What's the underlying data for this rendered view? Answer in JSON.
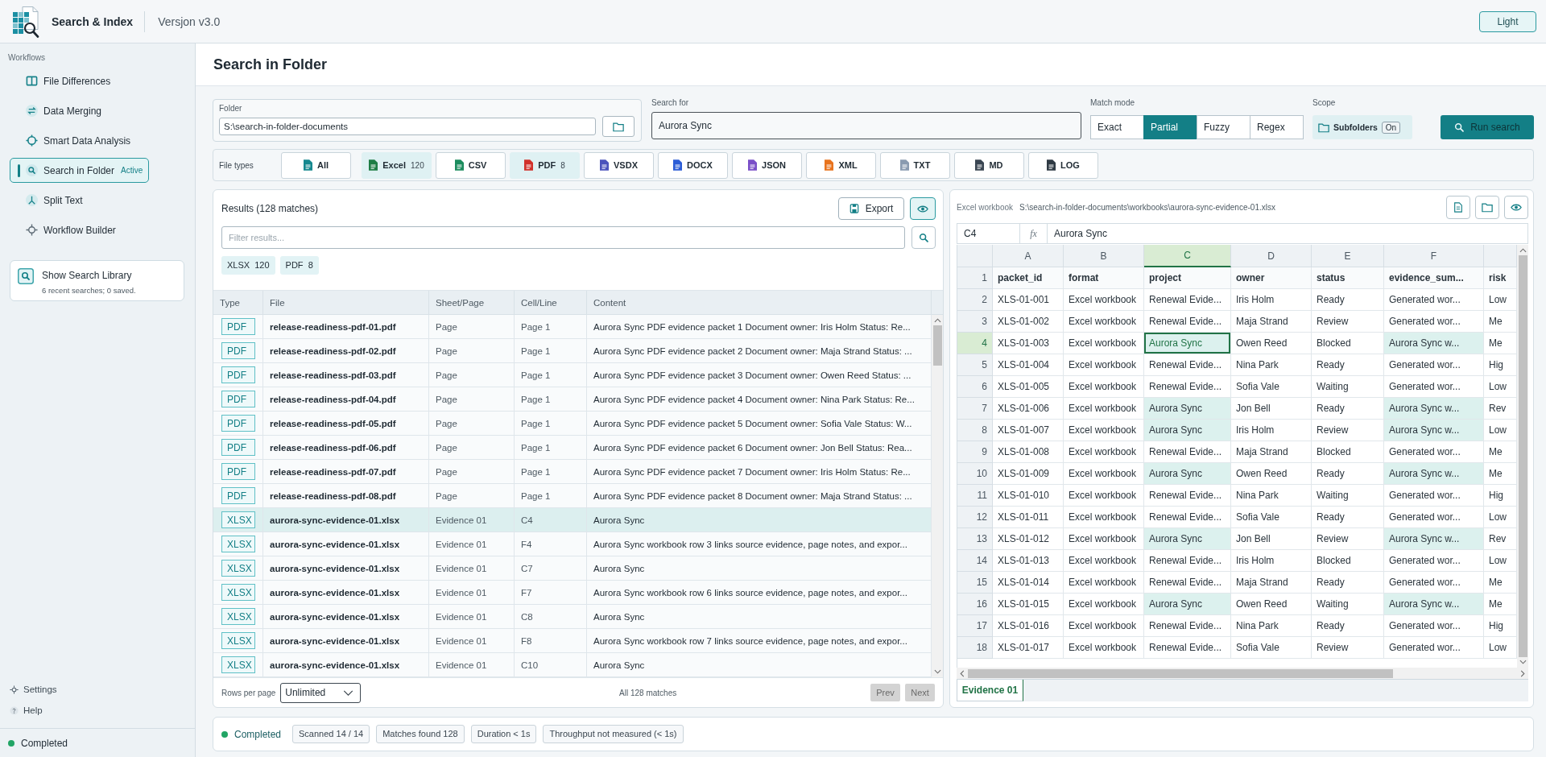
{
  "app": {
    "title": "Search & Index",
    "version": "Versjon v3.0",
    "theme_button": "Light"
  },
  "sidebar": {
    "section_label": "Workflows",
    "items": [
      {
        "label": "File Differences",
        "selected": false
      },
      {
        "label": "Data Merging",
        "selected": false
      },
      {
        "label": "Smart Data Analysis",
        "selected": false
      },
      {
        "label": "Search in Folder",
        "selected": true,
        "badge": "Active"
      },
      {
        "label": "Split Text",
        "selected": false
      },
      {
        "label": "Workflow Builder",
        "selected": false
      }
    ],
    "library_card": {
      "title": "Show Search Library",
      "subtitle": "6 recent searches; 0 saved."
    },
    "footer_links": [
      "Settings",
      "Help"
    ],
    "status": {
      "label": "Completed",
      "ok": true
    }
  },
  "page": {
    "title": "Search in Folder"
  },
  "search": {
    "folder": {
      "label": "Folder",
      "value": "S:\\search-in-folder-documents"
    },
    "query": {
      "label": "Search for",
      "value": "Aurora Sync",
      "focused": true
    },
    "match_mode": {
      "label": "Match mode",
      "options": [
        {
          "label": "Exact",
          "selected": false
        },
        {
          "label": "Partial",
          "selected": true
        },
        {
          "label": "Fuzzy",
          "selected": false
        },
        {
          "label": "Regex",
          "selected": false
        }
      ]
    },
    "scope": {
      "label": "Scope",
      "option": "Subfolders",
      "toggle": "On",
      "on": true
    },
    "run_button": "Run search"
  },
  "file_types": {
    "label": "File types",
    "items": [
      {
        "label": "All",
        "selected": false,
        "color": "#16888f"
      },
      {
        "label": "Excel",
        "count": "120",
        "selected": true,
        "color": "#1e7d45"
      },
      {
        "label": "CSV",
        "selected": false,
        "color": "#1c8c5e"
      },
      {
        "label": "PDF",
        "count": "8",
        "selected": true,
        "color": "#d1312b"
      },
      {
        "label": "VSDX",
        "selected": false,
        "color": "#4b53bc"
      },
      {
        "label": "DOCX",
        "selected": false,
        "color": "#2b5cd6"
      },
      {
        "label": "JSON",
        "selected": false,
        "color": "#7a4fc8"
      },
      {
        "label": "XML",
        "selected": false,
        "color": "#e8731d"
      },
      {
        "label": "TXT",
        "selected": false,
        "color": "#8a9bb0"
      },
      {
        "label": "MD",
        "selected": false,
        "color": "#3a4652"
      },
      {
        "label": "LOG",
        "selected": false,
        "color": "#2f3a44"
      }
    ]
  },
  "results": {
    "title": "Results (128 matches)",
    "export_button": "Export",
    "preview_toggle": {
      "on": true
    },
    "filter": {
      "placeholder": "Filter results..."
    },
    "type_chips": [
      {
        "label": "XLSX",
        "count": "120"
      },
      {
        "label": "PDF",
        "count": "8"
      }
    ],
    "columns": [
      "Type",
      "File",
      "Sheet/Page",
      "Cell/Line",
      "Content"
    ],
    "rows": [
      {
        "type": "PDF",
        "file": "release-readiness-pdf-01.pdf",
        "sheet": "Page",
        "cell": "Page 1",
        "content": "Aurora Sync PDF evidence packet 1 Document owner: Iris Holm Status: Re...",
        "selected": false
      },
      {
        "type": "PDF",
        "file": "release-readiness-pdf-02.pdf",
        "sheet": "Page",
        "cell": "Page 1",
        "content": "Aurora Sync PDF evidence packet 2 Document owner: Maja Strand Status: ...",
        "selected": false
      },
      {
        "type": "PDF",
        "file": "release-readiness-pdf-03.pdf",
        "sheet": "Page",
        "cell": "Page 1",
        "content": "Aurora Sync PDF evidence packet 3 Document owner: Owen Reed Status: ...",
        "selected": false
      },
      {
        "type": "PDF",
        "file": "release-readiness-pdf-04.pdf",
        "sheet": "Page",
        "cell": "Page 1",
        "content": "Aurora Sync PDF evidence packet 4 Document owner: Nina Park Status: Re...",
        "selected": false
      },
      {
        "type": "PDF",
        "file": "release-readiness-pdf-05.pdf",
        "sheet": "Page",
        "cell": "Page 1",
        "content": "Aurora Sync PDF evidence packet 5 Document owner: Sofia Vale Status: W...",
        "selected": false
      },
      {
        "type": "PDF",
        "file": "release-readiness-pdf-06.pdf",
        "sheet": "Page",
        "cell": "Page 1",
        "content": "Aurora Sync PDF evidence packet 6 Document owner: Jon Bell Status: Rea...",
        "selected": false
      },
      {
        "type": "PDF",
        "file": "release-readiness-pdf-07.pdf",
        "sheet": "Page",
        "cell": "Page 1",
        "content": "Aurora Sync PDF evidence packet 7 Document owner: Iris Holm Status: Re...",
        "selected": false
      },
      {
        "type": "PDF",
        "file": "release-readiness-pdf-08.pdf",
        "sheet": "Page",
        "cell": "Page 1",
        "content": "Aurora Sync PDF evidence packet 8 Document owner: Maja Strand Status: ...",
        "selected": false
      },
      {
        "type": "XLSX",
        "file": "aurora-sync-evidence-01.xlsx",
        "sheet": "Evidence 01",
        "cell": "C4",
        "content": "Aurora Sync",
        "selected": true
      },
      {
        "type": "XLSX",
        "file": "aurora-sync-evidence-01.xlsx",
        "sheet": "Evidence 01",
        "cell": "F4",
        "content": "Aurora Sync workbook row 3 links source evidence, page notes, and expor...",
        "selected": false
      },
      {
        "type": "XLSX",
        "file": "aurora-sync-evidence-01.xlsx",
        "sheet": "Evidence 01",
        "cell": "C7",
        "content": "Aurora Sync",
        "selected": false
      },
      {
        "type": "XLSX",
        "file": "aurora-sync-evidence-01.xlsx",
        "sheet": "Evidence 01",
        "cell": "F7",
        "content": "Aurora Sync workbook row 6 links source evidence, page notes, and expor...",
        "selected": false
      },
      {
        "type": "XLSX",
        "file": "aurora-sync-evidence-01.xlsx",
        "sheet": "Evidence 01",
        "cell": "C8",
        "content": "Aurora Sync",
        "selected": false
      },
      {
        "type": "XLSX",
        "file": "aurora-sync-evidence-01.xlsx",
        "sheet": "Evidence 01",
        "cell": "F8",
        "content": "Aurora Sync workbook row 7 links source evidence, page notes, and expor...",
        "selected": false
      },
      {
        "type": "XLSX",
        "file": "aurora-sync-evidence-01.xlsx",
        "sheet": "Evidence 01",
        "cell": "C10",
        "content": "Aurora Sync",
        "selected": false
      }
    ],
    "footer": {
      "rows_per_page_label": "Rows per page",
      "rows_per_page": "Unlimited",
      "summary": "All 128 matches",
      "prev": {
        "label": "Prev",
        "disabled": true
      },
      "next": {
        "label": "Next",
        "disabled": true
      }
    }
  },
  "preview": {
    "kind_label": "Excel workbook",
    "path": "S:\\search-in-folder-documents\\workbooks\\aurora-sync-evidence-01.xlsx",
    "formula_bar": {
      "cell": "C4",
      "fx": "fx",
      "value": "Aurora Sync"
    },
    "sheet": {
      "columns": [
        {
          "letter": "A",
          "selected": false
        },
        {
          "letter": "B",
          "selected": false
        },
        {
          "letter": "C",
          "selected": true
        },
        {
          "letter": "D",
          "selected": false
        },
        {
          "letter": "E",
          "selected": false
        },
        {
          "letter": "F",
          "selected": false
        }
      ],
      "rows": [
        {
          "number": "1",
          "selected": false,
          "header": true,
          "cells": [
            {
              "text": "packet_id",
              "match": false
            },
            {
              "text": "format",
              "match": false
            },
            {
              "text": "project",
              "match": false
            },
            {
              "text": "owner",
              "match": false
            },
            {
              "text": "status",
              "match": false
            },
            {
              "text": "evidence_sum...",
              "match": false
            },
            {
              "text": "risk",
              "match": false
            }
          ]
        },
        {
          "number": "2",
          "selected": false,
          "header": false,
          "cells": [
            {
              "text": "XLS-01-001",
              "match": false
            },
            {
              "text": "Excel workbook",
              "match": false
            },
            {
              "text": "Renewal Evide...",
              "match": false
            },
            {
              "text": "Iris Holm",
              "match": false
            },
            {
              "text": "Ready",
              "match": false
            },
            {
              "text": "Generated wor...",
              "match": false
            },
            {
              "text": "Low",
              "match": false
            }
          ]
        },
        {
          "number": "3",
          "selected": false,
          "header": false,
          "cells": [
            {
              "text": "XLS-01-002",
              "match": false
            },
            {
              "text": "Excel workbook",
              "match": false
            },
            {
              "text": "Renewal Evide...",
              "match": false
            },
            {
              "text": "Maja Strand",
              "match": false
            },
            {
              "text": "Review",
              "match": false
            },
            {
              "text": "Generated wor...",
              "match": false
            },
            {
              "text": "Me",
              "match": false
            }
          ]
        },
        {
          "number": "4",
          "selected": true,
          "header": false,
          "cells": [
            {
              "text": "XLS-01-003",
              "match": false
            },
            {
              "text": "Excel workbook",
              "match": false
            },
            {
              "text": "Aurora Sync",
              "match": true
            },
            {
              "text": "Owen Reed",
              "match": false
            },
            {
              "text": "Blocked",
              "match": false
            },
            {
              "text": "Aurora Sync w...",
              "match": true
            },
            {
              "text": "Me",
              "match": false
            }
          ]
        },
        {
          "number": "5",
          "selected": false,
          "header": false,
          "cells": [
            {
              "text": "XLS-01-004",
              "match": false
            },
            {
              "text": "Excel workbook",
              "match": false
            },
            {
              "text": "Renewal Evide...",
              "match": false
            },
            {
              "text": "Nina Park",
              "match": false
            },
            {
              "text": "Ready",
              "match": false
            },
            {
              "text": "Generated wor...",
              "match": false
            },
            {
              "text": "Hig",
              "match": false
            }
          ]
        },
        {
          "number": "6",
          "selected": false,
          "header": false,
          "cells": [
            {
              "text": "XLS-01-005",
              "match": false
            },
            {
              "text": "Excel workbook",
              "match": false
            },
            {
              "text": "Renewal Evide...",
              "match": false
            },
            {
              "text": "Sofia Vale",
              "match": false
            },
            {
              "text": "Waiting",
              "match": false
            },
            {
              "text": "Generated wor...",
              "match": false
            },
            {
              "text": "Low",
              "match": false
            }
          ]
        },
        {
          "number": "7",
          "selected": false,
          "header": false,
          "cells": [
            {
              "text": "XLS-01-006",
              "match": false
            },
            {
              "text": "Excel workbook",
              "match": false
            },
            {
              "text": "Aurora Sync",
              "match": true
            },
            {
              "text": "Jon Bell",
              "match": false
            },
            {
              "text": "Ready",
              "match": false
            },
            {
              "text": "Aurora Sync w...",
              "match": true
            },
            {
              "text": "Rev",
              "match": false
            }
          ]
        },
        {
          "number": "8",
          "selected": false,
          "header": false,
          "cells": [
            {
              "text": "XLS-01-007",
              "match": false
            },
            {
              "text": "Excel workbook",
              "match": false
            },
            {
              "text": "Aurora Sync",
              "match": true
            },
            {
              "text": "Iris Holm",
              "match": false
            },
            {
              "text": "Review",
              "match": false
            },
            {
              "text": "Aurora Sync w...",
              "match": true
            },
            {
              "text": "Low",
              "match": false
            }
          ]
        },
        {
          "number": "9",
          "selected": false,
          "header": false,
          "cells": [
            {
              "text": "XLS-01-008",
              "match": false
            },
            {
              "text": "Excel workbook",
              "match": false
            },
            {
              "text": "Renewal Evide...",
              "match": false
            },
            {
              "text": "Maja Strand",
              "match": false
            },
            {
              "text": "Blocked",
              "match": false
            },
            {
              "text": "Generated wor...",
              "match": false
            },
            {
              "text": "Me",
              "match": false
            }
          ]
        },
        {
          "number": "10",
          "selected": false,
          "header": false,
          "cells": [
            {
              "text": "XLS-01-009",
              "match": false
            },
            {
              "text": "Excel workbook",
              "match": false
            },
            {
              "text": "Aurora Sync",
              "match": true
            },
            {
              "text": "Owen Reed",
              "match": false
            },
            {
              "text": "Ready",
              "match": false
            },
            {
              "text": "Aurora Sync w...",
              "match": true
            },
            {
              "text": "Me",
              "match": false
            }
          ]
        },
        {
          "number": "11",
          "selected": false,
          "header": false,
          "cells": [
            {
              "text": "XLS-01-010",
              "match": false
            },
            {
              "text": "Excel workbook",
              "match": false
            },
            {
              "text": "Renewal Evide...",
              "match": false
            },
            {
              "text": "Nina Park",
              "match": false
            },
            {
              "text": "Waiting",
              "match": false
            },
            {
              "text": "Generated wor...",
              "match": false
            },
            {
              "text": "Hig",
              "match": false
            }
          ]
        },
        {
          "number": "12",
          "selected": false,
          "header": false,
          "cells": [
            {
              "text": "XLS-01-011",
              "match": false
            },
            {
              "text": "Excel workbook",
              "match": false
            },
            {
              "text": "Renewal Evide...",
              "match": false
            },
            {
              "text": "Sofia Vale",
              "match": false
            },
            {
              "text": "Ready",
              "match": false
            },
            {
              "text": "Generated wor...",
              "match": false
            },
            {
              "text": "Low",
              "match": false
            }
          ]
        },
        {
          "number": "13",
          "selected": false,
          "header": false,
          "cells": [
            {
              "text": "XLS-01-012",
              "match": false
            },
            {
              "text": "Excel workbook",
              "match": false
            },
            {
              "text": "Aurora Sync",
              "match": true
            },
            {
              "text": "Jon Bell",
              "match": false
            },
            {
              "text": "Review",
              "match": false
            },
            {
              "text": "Aurora Sync w...",
              "match": true
            },
            {
              "text": "Rev",
              "match": false
            }
          ]
        },
        {
          "number": "14",
          "selected": false,
          "header": false,
          "cells": [
            {
              "text": "XLS-01-013",
              "match": false
            },
            {
              "text": "Excel workbook",
              "match": false
            },
            {
              "text": "Renewal Evide...",
              "match": false
            },
            {
              "text": "Iris Holm",
              "match": false
            },
            {
              "text": "Blocked",
              "match": false
            },
            {
              "text": "Generated wor...",
              "match": false
            },
            {
              "text": "Low",
              "match": false
            }
          ]
        },
        {
          "number": "15",
          "selected": false,
          "header": false,
          "cells": [
            {
              "text": "XLS-01-014",
              "match": false
            },
            {
              "text": "Excel workbook",
              "match": false
            },
            {
              "text": "Renewal Evide...",
              "match": false
            },
            {
              "text": "Maja Strand",
              "match": false
            },
            {
              "text": "Ready",
              "match": false
            },
            {
              "text": "Generated wor...",
              "match": false
            },
            {
              "text": "Me",
              "match": false
            }
          ]
        },
        {
          "number": "16",
          "selected": false,
          "header": false,
          "cells": [
            {
              "text": "XLS-01-015",
              "match": false
            },
            {
              "text": "Excel workbook",
              "match": false
            },
            {
              "text": "Aurora Sync",
              "match": true
            },
            {
              "text": "Owen Reed",
              "match": false
            },
            {
              "text": "Waiting",
              "match": false
            },
            {
              "text": "Aurora Sync w...",
              "match": true
            },
            {
              "text": "Me",
              "match": false
            }
          ]
        },
        {
          "number": "17",
          "selected": false,
          "header": false,
          "cells": [
            {
              "text": "XLS-01-016",
              "match": false
            },
            {
              "text": "Excel workbook",
              "match": false
            },
            {
              "text": "Renewal Evide...",
              "match": false
            },
            {
              "text": "Nina Park",
              "match": false
            },
            {
              "text": "Ready",
              "match": false
            },
            {
              "text": "Generated wor...",
              "match": false
            },
            {
              "text": "Hig",
              "match": false
            }
          ]
        },
        {
          "number": "18",
          "selected": false,
          "header": false,
          "cells": [
            {
              "text": "XLS-01-017",
              "match": false
            },
            {
              "text": "Excel workbook",
              "match": false
            },
            {
              "text": "Renewal Evide...",
              "match": false
            },
            {
              "text": "Sofia Vale",
              "match": false
            },
            {
              "text": "Review",
              "match": false
            },
            {
              "text": "Generated wor...",
              "match": false
            },
            {
              "text": "Low",
              "match": false
            }
          ]
        }
      ]
    },
    "tabs": [
      {
        "label": "Evidence 01",
        "selected": true
      }
    ]
  },
  "status_bar": {
    "label": "Completed",
    "ok": true,
    "chips": [
      "Scanned 14 / 14",
      "Matches found 128",
      "Duration < 1s",
      "Throughput not measured (< 1s)"
    ]
  }
}
